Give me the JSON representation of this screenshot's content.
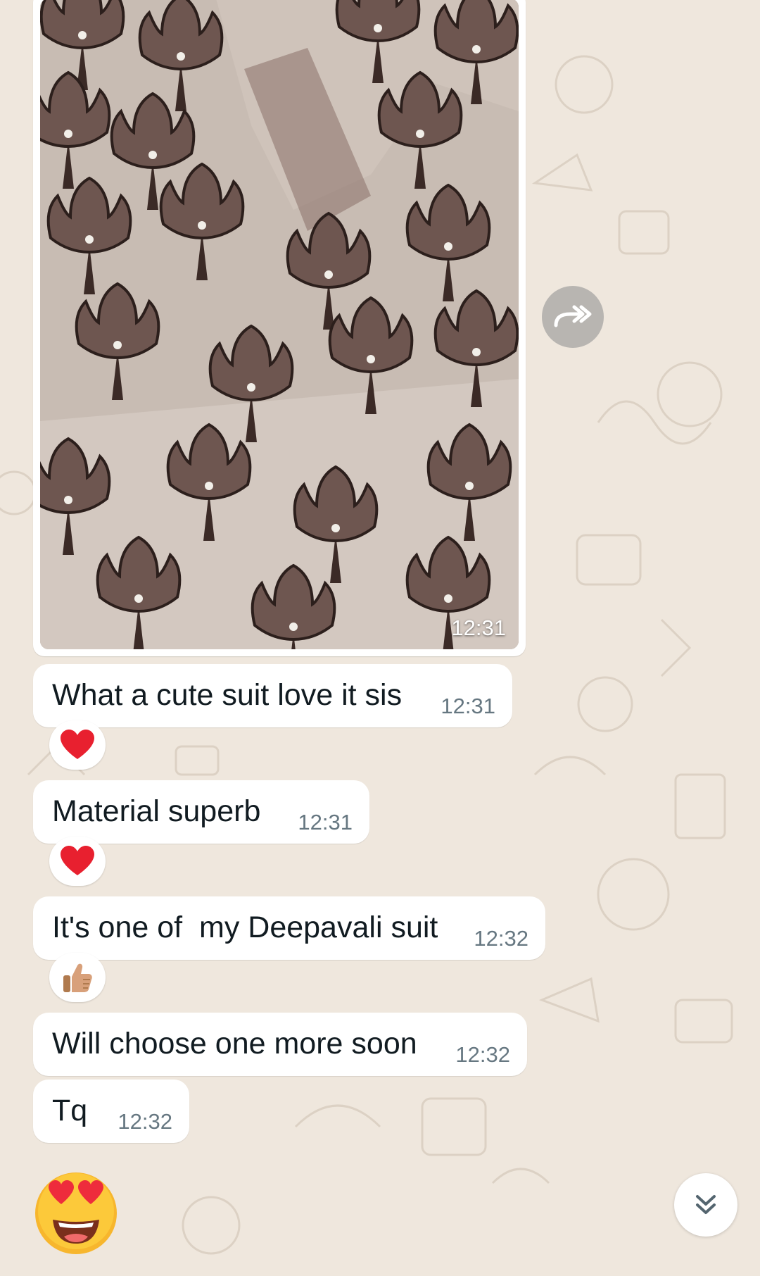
{
  "photo_message": {
    "time": "12:31"
  },
  "messages": [
    {
      "text": "What a cute suit love it sis",
      "time": "12:31",
      "reaction": "heart"
    },
    {
      "text": "Material superb",
      "time": "12:31",
      "reaction": "heart"
    },
    {
      "text": "It's one of  my Deepavali suit",
      "time": "12:32",
      "reaction": "thumbs-up"
    },
    {
      "text": "Will choose one more soon",
      "time": "12:32"
    },
    {
      "text": "Tq",
      "time": "12:32"
    }
  ],
  "icons": {
    "forward": "forward-icon",
    "heart": "heart-icon",
    "thumbs_up": "thumbs-up-icon",
    "scroll_down": "double-chevron-down-icon",
    "sticker": "heart-eyes-emoji-icon"
  },
  "colors": {
    "background": "#efe7dd",
    "bubble": "#ffffff",
    "text": "#111b21",
    "timestamp": "#667781",
    "heart": "#e8202f"
  }
}
